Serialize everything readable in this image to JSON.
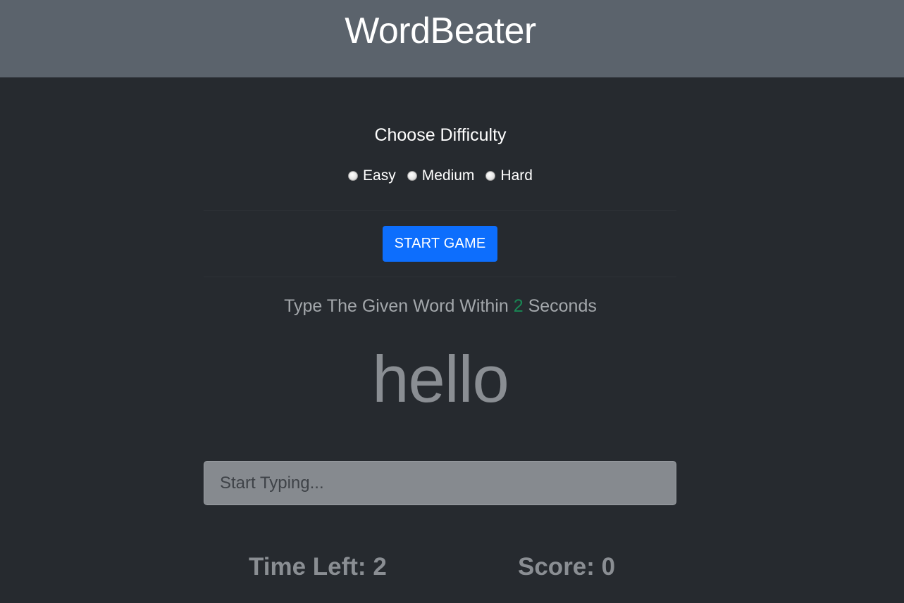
{
  "header": {
    "brand": "WordBeater"
  },
  "difficulty": {
    "title": "Choose Difficulty",
    "options": [
      {
        "label": "Easy",
        "selected": false
      },
      {
        "label": "Medium",
        "selected": false
      },
      {
        "label": "Hard",
        "selected": false
      }
    ]
  },
  "start_button": {
    "label": "START GAME",
    "color": "#0d6efd"
  },
  "instructions": {
    "prefix": "Type The Given Word Within ",
    "seconds": "2",
    "suffix": " Seconds",
    "seconds_color": "#198754"
  },
  "game": {
    "current_word": "hello",
    "input_placeholder": "Start Typing...",
    "time_left_label": "Time Left: ",
    "time_left_value": "2",
    "score_label": "Score: ",
    "score_value": "0"
  },
  "colors": {
    "header_bg": "#5b636c",
    "page_bg": "#262a2f"
  }
}
